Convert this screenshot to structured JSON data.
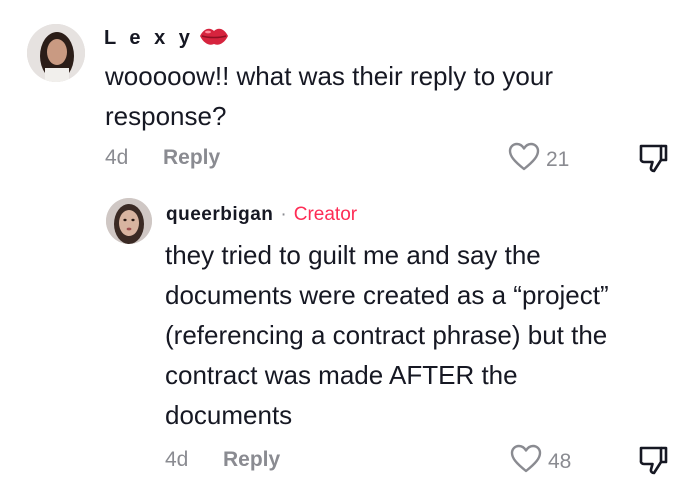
{
  "comment": {
    "author": "L e x y",
    "author_emoji_icon": "kiss-lips-icon",
    "text_line1": "wooooow!! what was their reply to your",
    "text_line2": "response?",
    "age": "4d",
    "reply_label": "Reply",
    "like_count": "21"
  },
  "reply": {
    "author": "queerbigan",
    "separator": "·",
    "badge": "Creator",
    "lines": [
      "they tried to guilt me and say the",
      "documents were created as a “project”",
      "(referencing a contract phrase) but the",
      "contract was made AFTER the",
      "documents"
    ],
    "age": "4d",
    "reply_label": "Reply",
    "like_count": "48"
  },
  "colors": {
    "creator": "#fe2c55",
    "muted": "#8a8b91",
    "text": "#161823",
    "lips": "#d6243e"
  }
}
